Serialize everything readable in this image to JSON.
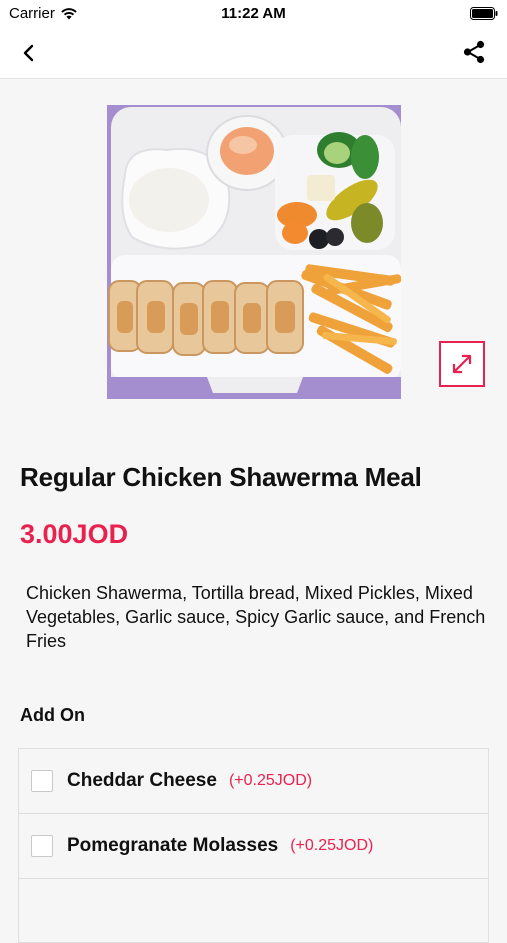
{
  "status_bar": {
    "carrier": "Carrier",
    "time": "11:22 AM"
  },
  "nav": {
    "back_icon": "chevron-left-icon",
    "share_icon": "share-icon"
  },
  "product": {
    "image_alt": "chicken shawerma meal tray",
    "title": "Regular Chicken Shawerma Meal",
    "price": "3.00JOD",
    "description": "Chicken Shawerma, Tortilla bread, Mixed Pickles, Mixed Vegetables, Garlic sauce, Spicy Garlic sauce, and French Fries"
  },
  "addons": {
    "heading": "Add On",
    "items": [
      {
        "name": "Cheddar Cheese",
        "price": "(+0.25JOD)"
      },
      {
        "name": "Pomegranate Molasses",
        "price": "(+0.25JOD)"
      },
      {
        "name": "",
        "price": ""
      }
    ]
  },
  "colors": {
    "accent": "#e8214f",
    "background": "#f6f6f6"
  }
}
